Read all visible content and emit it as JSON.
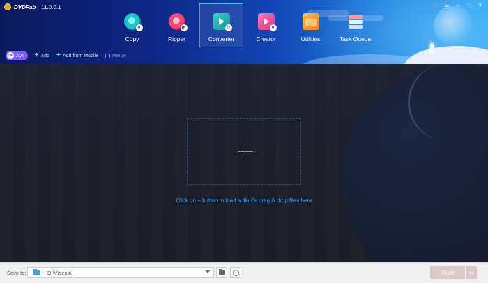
{
  "app": {
    "brand": "DVDFab",
    "version": "11.0.0.1"
  },
  "window_controls": [
    "cart-icon",
    "menu-icon",
    "minimize-icon",
    "maximize-icon",
    "close-icon"
  ],
  "modules": [
    {
      "key": "copy",
      "label": "Copy",
      "icon": "copy-disc-icon",
      "active": false
    },
    {
      "key": "ripper",
      "label": "Ripper",
      "icon": "ripper-disc-icon",
      "active": false
    },
    {
      "key": "converter",
      "label": "Converter",
      "icon": "converter-film-icon",
      "active": true
    },
    {
      "key": "creator",
      "label": "Creator",
      "icon": "creator-film-icon",
      "active": false
    },
    {
      "key": "utilities",
      "label": "Utilities",
      "icon": "utilities-folder-icon",
      "active": false
    },
    {
      "key": "taskqueue",
      "label": "Task Queue",
      "icon": "task-queue-icon",
      "active": false
    }
  ],
  "toolbar": {
    "format_label": "AVI",
    "add_label": "Add",
    "add_mobile_label": "Add from Mobile",
    "merge_label": "Merge"
  },
  "main": {
    "drop_hint": "Click on + button to load a file Or drag & drop files here"
  },
  "bottom": {
    "save_to_label": "Save to:",
    "save_path": "D:\\Videos\\",
    "start_label": "Start"
  },
  "colors": {
    "accent": "#3ea3f3",
    "active_module_border": "#46b3ff",
    "format_pill": "#7b5cff",
    "start_button_disabled": "#dcc8c8"
  }
}
